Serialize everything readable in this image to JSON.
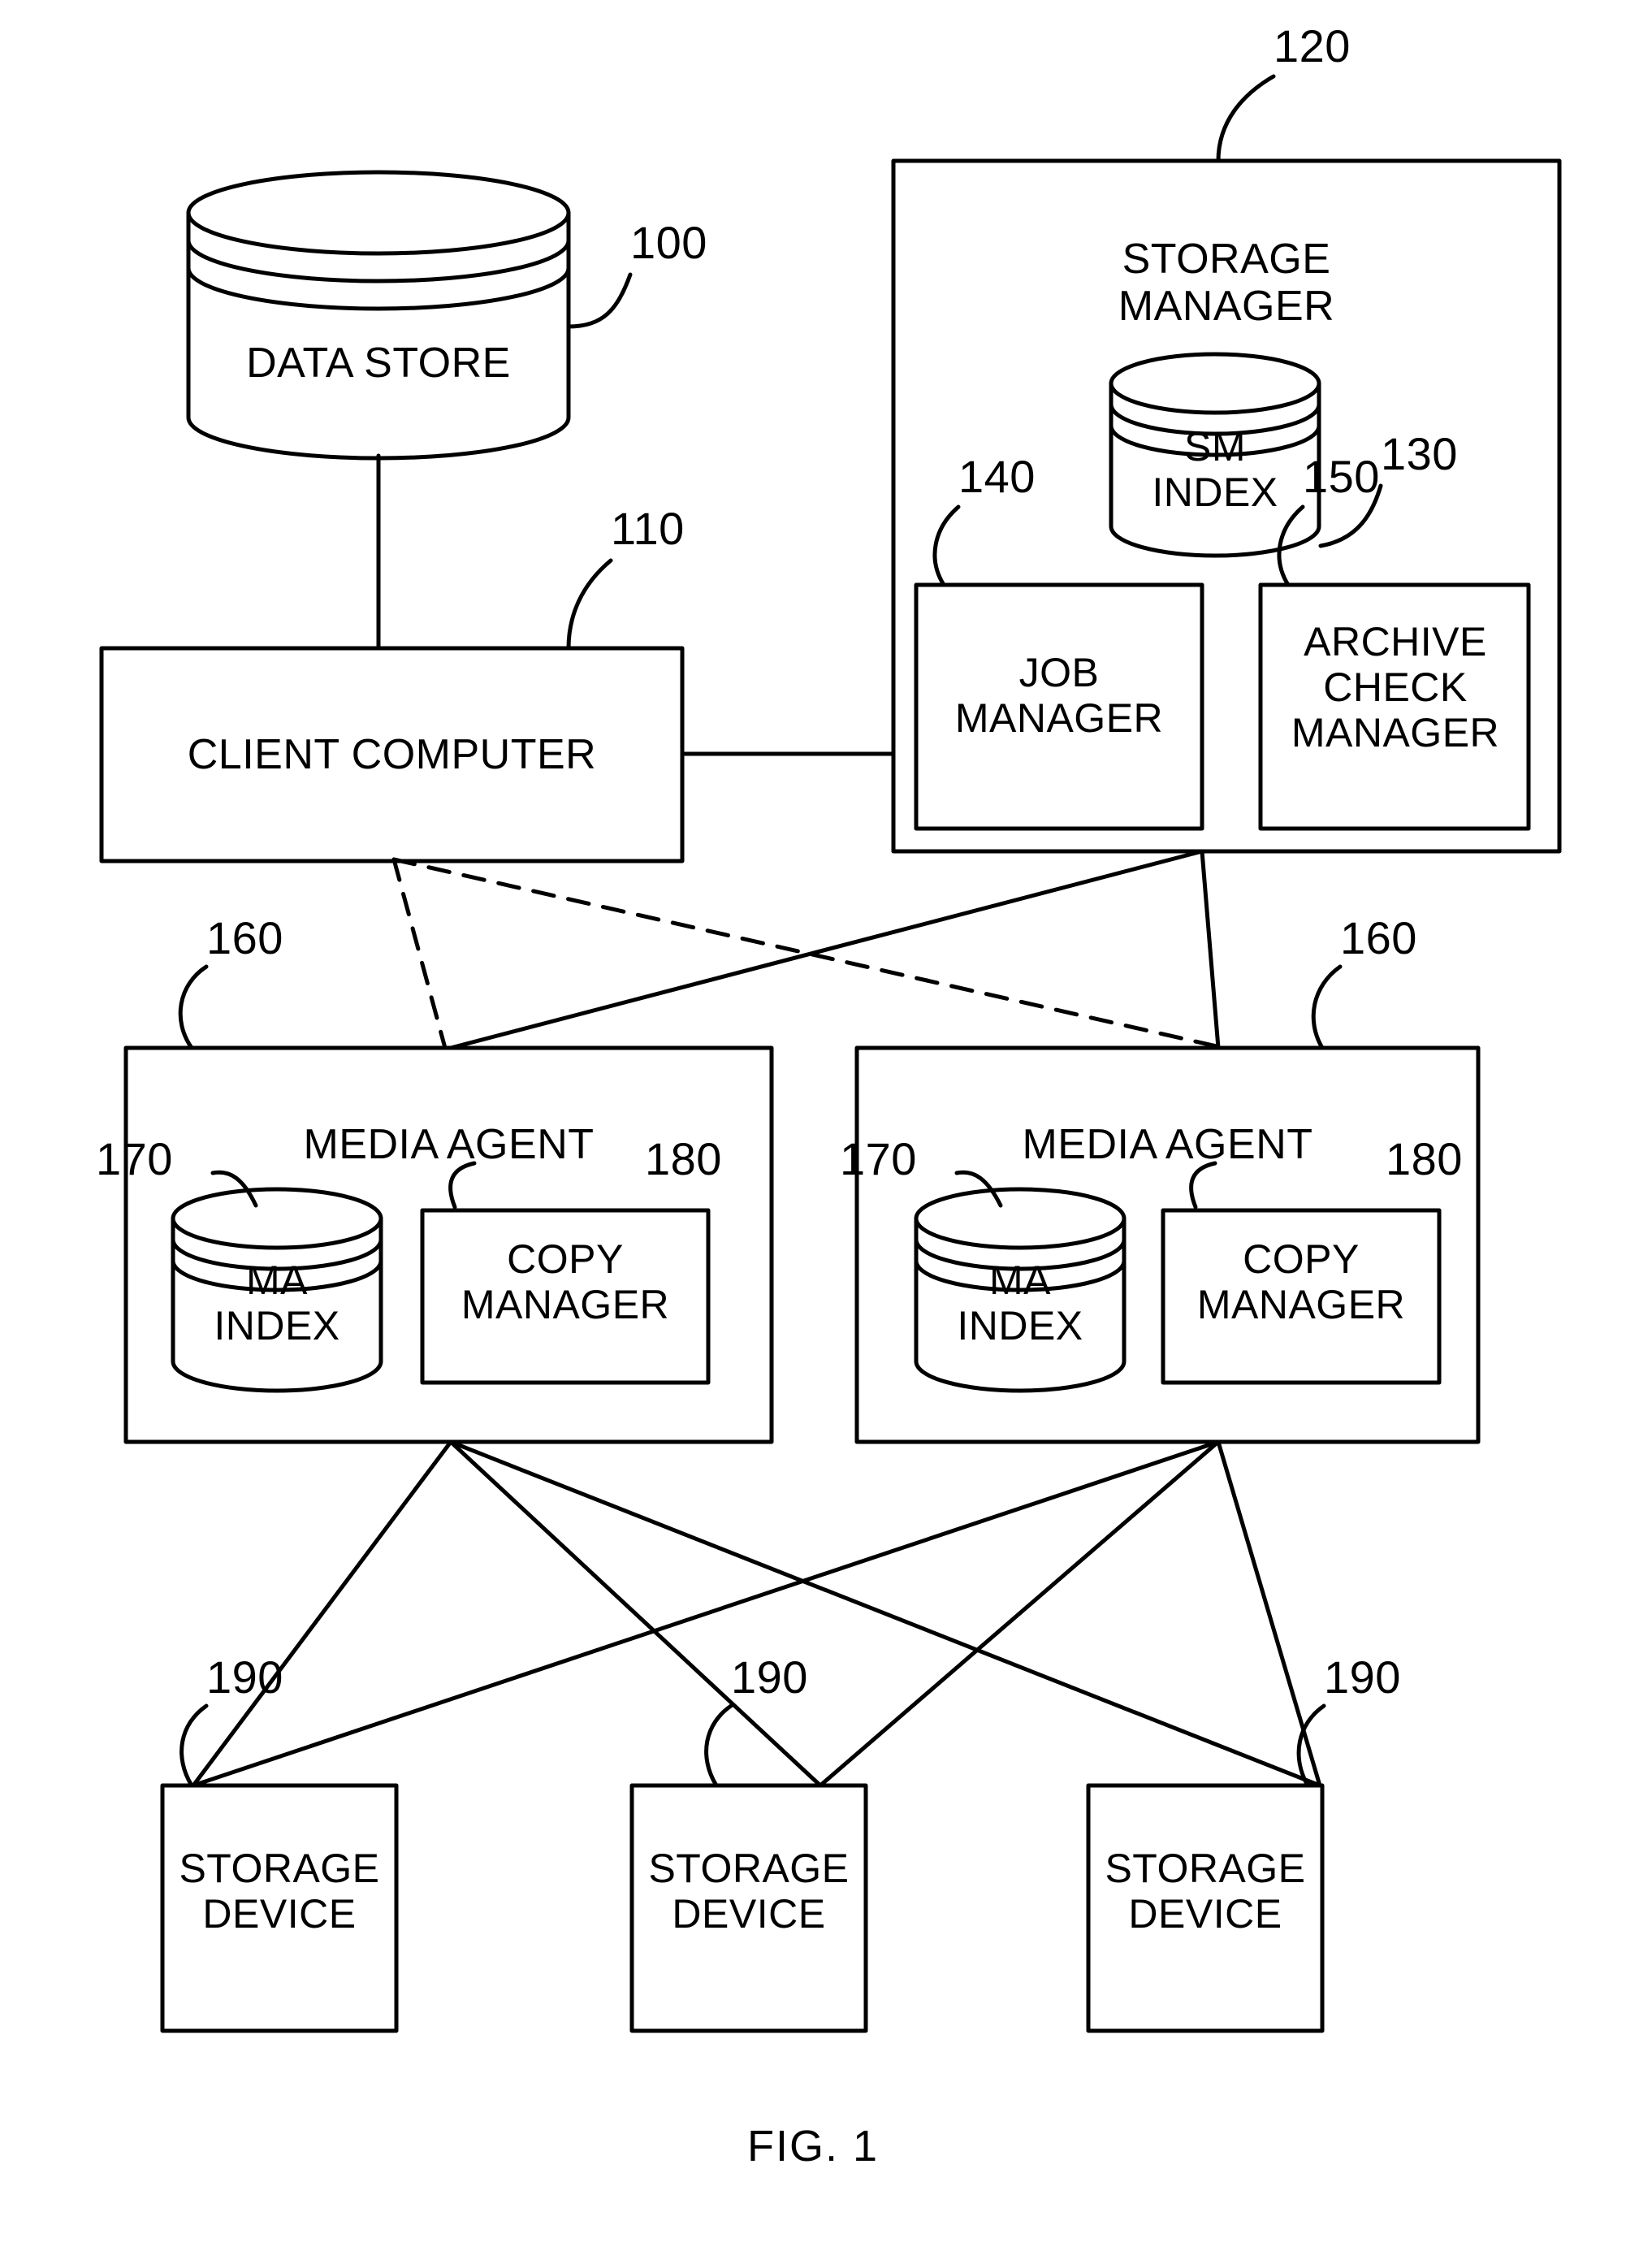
{
  "figure": {
    "caption": "FIG. 1",
    "title": "Storage Management System"
  },
  "nodes": {
    "data_store": {
      "label": "DATA STORE",
      "ref": "100",
      "shape": "cylinder"
    },
    "client_computer": {
      "label": "CLIENT COMPUTER",
      "ref": "110",
      "shape": "rect"
    },
    "storage_manager": {
      "label": "STORAGE\nMANAGER",
      "ref": "120",
      "shape": "rect"
    },
    "sm_index": {
      "label": "SM\nINDEX",
      "ref": "130",
      "shape": "cylinder"
    },
    "job_manager": {
      "label": "JOB\nMANAGER",
      "ref": "140",
      "shape": "rect"
    },
    "archive_check_manager": {
      "label": "ARCHIVE\nCHECK\nMANAGER",
      "ref": "150",
      "shape": "rect"
    },
    "media_agent_left": {
      "label": "MEDIA AGENT",
      "ref": "160",
      "shape": "rect"
    },
    "media_agent_right": {
      "label": "MEDIA AGENT",
      "ref": "160",
      "shape": "rect"
    },
    "ma_index_left": {
      "label": "MA\nINDEX",
      "ref": "170",
      "shape": "cylinder"
    },
    "ma_index_right": {
      "label": "MA\nINDEX",
      "ref": "170",
      "shape": "cylinder"
    },
    "copy_manager_left": {
      "label": "COPY\nMANAGER",
      "ref": "180",
      "shape": "rect"
    },
    "copy_manager_right": {
      "label": "COPY\nMANAGER",
      "ref": "180",
      "shape": "rect"
    },
    "storage_device_1": {
      "label": "STORAGE\nDEVICE",
      "ref": "190",
      "shape": "rect"
    },
    "storage_device_2": {
      "label": "STORAGE\nDEVICE",
      "ref": "190",
      "shape": "rect"
    },
    "storage_device_3": {
      "label": "STORAGE\nDEVICE",
      "ref": "190",
      "shape": "rect"
    }
  },
  "style": {
    "stroke": "#000000",
    "background": "#ffffff",
    "line_width": 5
  }
}
